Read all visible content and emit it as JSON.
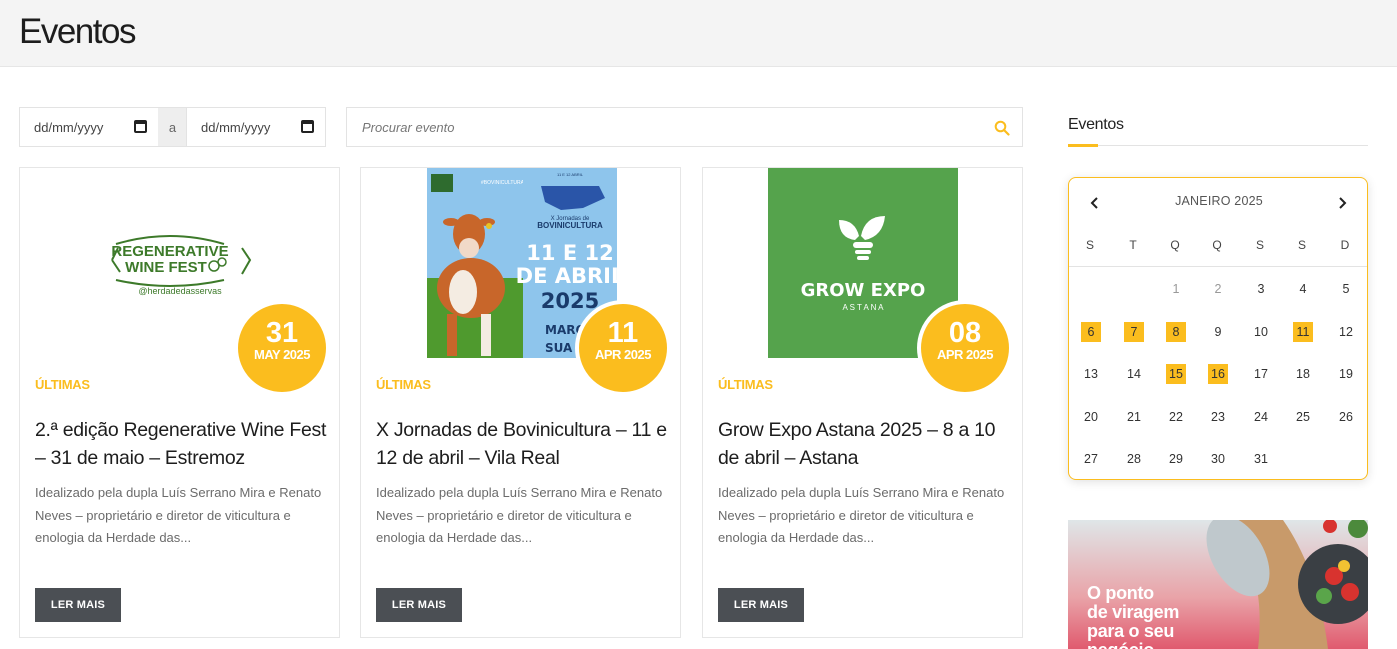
{
  "page": {
    "title": "Eventos"
  },
  "filters": {
    "date_from_placeholder": "dd/mm/yyyy",
    "separator": "a",
    "date_to_placeholder": "dd/mm/yyyy",
    "search_placeholder": "Procurar evento"
  },
  "colors": {
    "accent": "#fbbd1e",
    "button": "#4b4f54"
  },
  "cards": [
    {
      "badge_day": "31",
      "badge_month": "MAY 2025",
      "category": "ÚLTIMAS",
      "title": "2.ª edição Regenerative Wine Fest – 31 de maio – Estremoz",
      "excerpt": "Idealizado pela dupla Luís Serrano Mira e Renato Neves – proprietário e diretor de viticultura e enologia da Herdade das...",
      "button": "LER MAIS",
      "image": {
        "logo_line1": "REGENERATIVE",
        "logo_line2": "WINE FEST",
        "handle": "@herdadedasservas"
      }
    },
    {
      "badge_day": "11",
      "badge_month": "APR 2025",
      "category": "ÚLTIMAS",
      "title": "X Jornadas de Bovinicultura – 11 e 12 de abril – Vila Real",
      "excerpt": "Idealizado pela dupla Luís Serrano Mira e Renato Neves – proprietário e diretor de viticultura e enologia da Herdade das...",
      "button": "LER MAIS",
      "image": {
        "poster_small": "X Jornadas de",
        "poster_big": "BOVINICULTURA",
        "poster_date1": "11 E 12",
        "poster_date2": "DE ABRIL",
        "poster_year": "2025",
        "poster_footer1": "MARQUE",
        "poster_footer2": "SUA AG"
      }
    },
    {
      "badge_day": "08",
      "badge_month": "APR 2025",
      "category": "ÚLTIMAS",
      "title": "Grow Expo Astana 2025 – 8 a 10 de abril – Astana",
      "excerpt": "Idealizado pela dupla Luís Serrano Mira e Renato Neves – proprietário e diretor de viticultura e enologia da Herdade das...",
      "button": "LER MAIS",
      "image": {
        "logo_main": "GROW EXPO",
        "logo_sub": "A S T A N A"
      }
    }
  ],
  "sidebar": {
    "title": "Eventos",
    "calendar": {
      "month_label": "JANEIRO 2025",
      "weekdays": [
        "S",
        "T",
        "Q",
        "Q",
        "S",
        "S",
        "D"
      ],
      "weeks": [
        [
          {
            "d": ""
          },
          {
            "d": ""
          },
          {
            "d": "1",
            "dim": true
          },
          {
            "d": "2",
            "dim": true
          },
          {
            "d": "3"
          },
          {
            "d": "4"
          },
          {
            "d": "5"
          }
        ],
        [
          {
            "d": "6",
            "ev": true
          },
          {
            "d": "7",
            "ev": true
          },
          {
            "d": "8",
            "ev": true
          },
          {
            "d": "9"
          },
          {
            "d": "10"
          },
          {
            "d": "11",
            "ev": true
          },
          {
            "d": "12"
          }
        ],
        [
          {
            "d": "13"
          },
          {
            "d": "14"
          },
          {
            "d": "15",
            "ev": true
          },
          {
            "d": "16",
            "ev": true
          },
          {
            "d": "17"
          },
          {
            "d": "18"
          },
          {
            "d": "19"
          }
        ],
        [
          {
            "d": "20"
          },
          {
            "d": "21"
          },
          {
            "d": "22"
          },
          {
            "d": "23"
          },
          {
            "d": "24"
          },
          {
            "d": "25"
          },
          {
            "d": "26"
          }
        ],
        [
          {
            "d": "27"
          },
          {
            "d": "28"
          },
          {
            "d": "29"
          },
          {
            "d": "30"
          },
          {
            "d": "31"
          },
          {
            "d": ""
          },
          {
            "d": ""
          }
        ]
      ]
    },
    "ad": {
      "line1": "O ponto",
      "line2": "de viragem",
      "line3": "para o seu",
      "line4": "negócio"
    }
  }
}
